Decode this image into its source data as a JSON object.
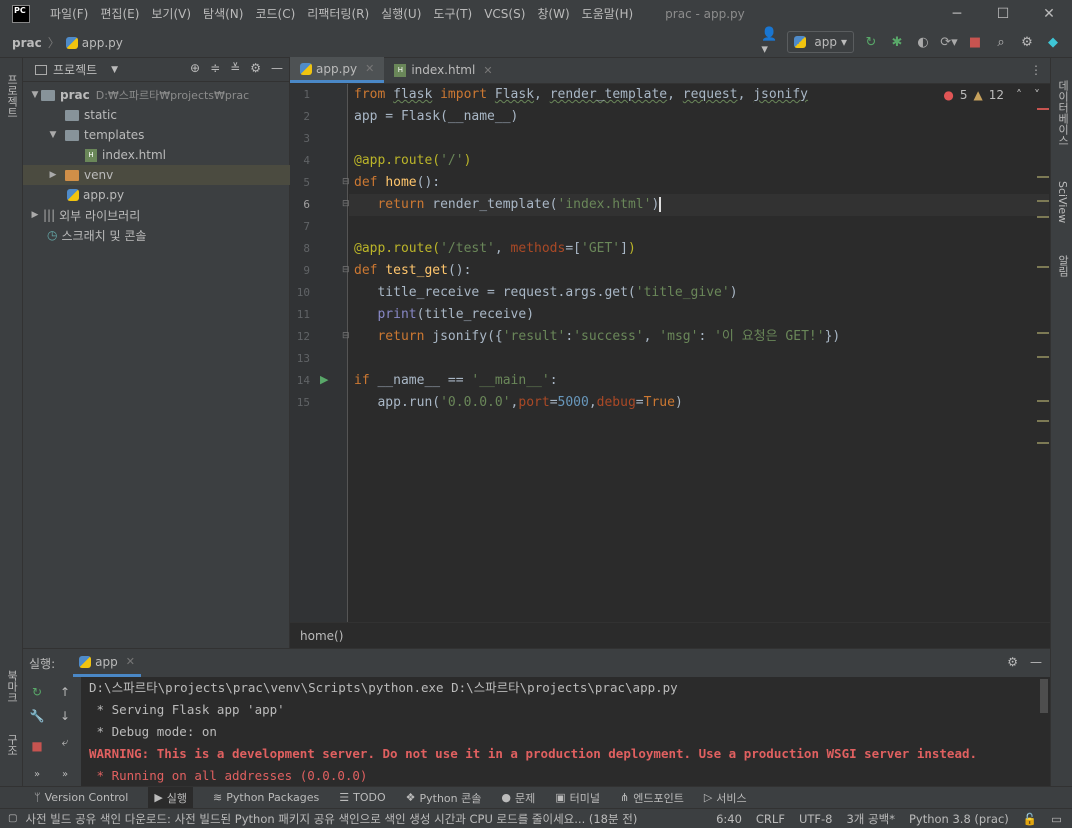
{
  "window": {
    "title": "prac - app.py",
    "logo": "PC",
    "controls": {
      "minimize": "─",
      "maximize": "☐",
      "close": "✕"
    }
  },
  "menu": [
    "파일(F)",
    "편집(E)",
    "보기(V)",
    "탐색(N)",
    "코드(C)",
    "리팩터링(R)",
    "실행(U)",
    "도구(T)",
    "VCS(S)",
    "창(W)",
    "도움말(H)"
  ],
  "navbar": {
    "project": "prac",
    "file": "app.py",
    "run_config": "app"
  },
  "left_stripe": {
    "project": "프로젝트",
    "bookmarks": "북마크",
    "structure": "구조"
  },
  "right_stripe": {
    "database": "데이터베이스",
    "sciview": "SciView",
    "notifications": "알림"
  },
  "project_panel": {
    "title": "프로젝트",
    "tree": [
      {
        "label": "prac",
        "detail": "D:₩스파르타₩projects₩prac",
        "type": "folder-root"
      },
      {
        "label": "static",
        "type": "folder"
      },
      {
        "label": "templates",
        "type": "folder"
      },
      {
        "label": "index.html",
        "type": "html"
      },
      {
        "label": "venv",
        "type": "folder-venv"
      },
      {
        "label": "app.py",
        "type": "py"
      },
      {
        "label": "외부 라이브러리",
        "type": "lib"
      },
      {
        "label": "스크래치 및 콘솔",
        "type": "scratch"
      }
    ]
  },
  "editor": {
    "tabs": [
      {
        "label": "app.py",
        "active": true
      },
      {
        "label": "index.html",
        "active": false
      }
    ],
    "inspection": {
      "errors": "5",
      "warnings": "12"
    },
    "line_numbers": [
      "1",
      "2",
      "3",
      "4",
      "5",
      "6",
      "7",
      "8",
      "9",
      "10",
      "11",
      "12",
      "13",
      "14",
      "15"
    ],
    "breadcrumb": "home()"
  },
  "run_panel": {
    "label": "실행:",
    "tab": "app",
    "console": [
      {
        "text": "D:\\스파르타\\projects\\prac\\venv\\Scripts\\python.exe D:\\스파르타\\projects\\prac\\app.py",
        "kind": "normal"
      },
      {
        "text": " * Serving Flask app 'app'",
        "kind": "normal"
      },
      {
        "text": " * Debug mode: on",
        "kind": "normal"
      },
      {
        "text": "WARNING: This is a development server. Do not use it in a production deployment. Use a production WSGI server instead.",
        "kind": "warn"
      },
      {
        "text": " * Running on all addresses (0.0.0.0)",
        "kind": "warn"
      }
    ]
  },
  "bottom_tools": [
    "Version Control",
    "실행",
    "Python Packages",
    "TODO",
    "Python 콘솔",
    "문제",
    "터미널",
    "엔드포인트",
    "서비스"
  ],
  "statusbar": {
    "message": "사전 빌드 공유 색인 다운로드: 사전 빌드된 Python 패키지 공유 색인으로 색인 생성 시간과 CPU 로드를 줄이세요... (18분 전)",
    "position": "6:40",
    "line_sep": "CRLF",
    "encoding": "UTF-8",
    "indent": "3개 공백*",
    "interpreter": "Python 3.8 (prac)"
  }
}
